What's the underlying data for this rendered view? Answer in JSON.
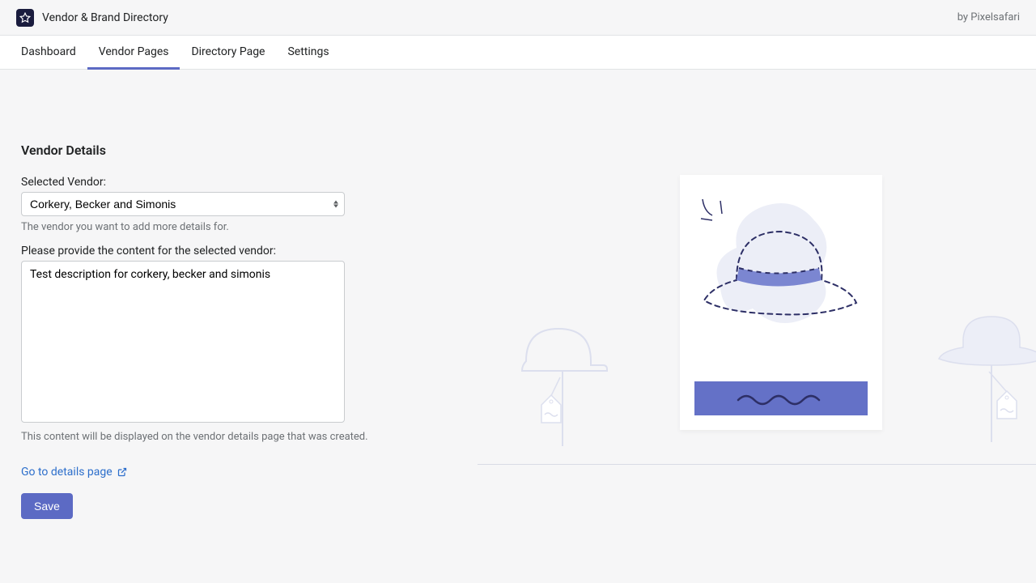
{
  "header": {
    "title": "Vendor & Brand Directory",
    "byline": "by Pixelsafari"
  },
  "nav": {
    "items": [
      {
        "label": "Dashboard"
      },
      {
        "label": "Vendor Pages"
      },
      {
        "label": "Directory Page"
      },
      {
        "label": "Settings"
      }
    ],
    "active_index": 1
  },
  "form": {
    "section_title": "Vendor Details",
    "vendor_label": "Selected Vendor:",
    "vendor_value": "Corkery, Becker and Simonis",
    "vendor_help": "The vendor you want to add more details for.",
    "content_label": "Please provide the content for the selected vendor:",
    "content_value": "Test description for corkery, becker and simonis",
    "content_help": "This content will be displayed on the vendor details page that was created.",
    "details_link": "Go to details page",
    "save_label": "Save"
  }
}
